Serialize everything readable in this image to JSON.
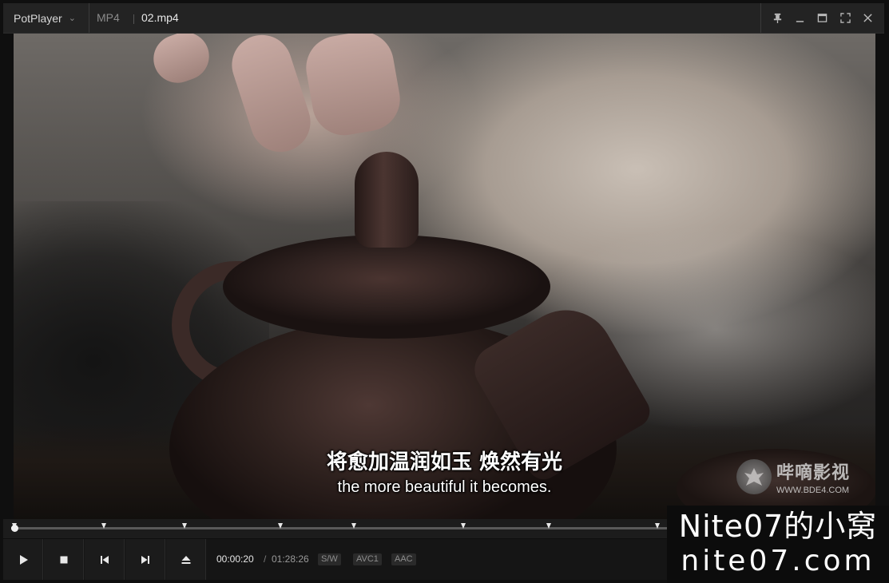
{
  "titlebar": {
    "app_name": "PotPlayer",
    "format": "MP4",
    "filename": "02.mp4",
    "controls": [
      "pin-icon",
      "minimize-icon",
      "maximize-icon",
      "fullscreen-icon",
      "close-icon"
    ]
  },
  "video": {
    "subtitle_cn": "将愈加温润如玉 焕然有光",
    "subtitle_en": "the more beautiful it becomes."
  },
  "watermark_bde": {
    "name": "哔嘀影视",
    "url": "WWW.BDE4.COM"
  },
  "seekbar": {
    "progress": 0.004,
    "chapter_marks": [
      0.004,
      0.107,
      0.2,
      0.311,
      0.395,
      0.522,
      0.62,
      0.746
    ]
  },
  "controls": {
    "buttons": [
      "play-icon",
      "stop-icon",
      "previous-icon",
      "next-icon",
      "eject-icon"
    ],
    "time_current": "00:00:20",
    "time_separator": "/",
    "time_total": "01:28:26",
    "badges": [
      "S/W",
      "AVC1",
      "AAC"
    ]
  },
  "watermark_nite": {
    "line1": "Nite07的小窝",
    "line2": "nite07.com"
  },
  "colors": {
    "titlebar_bg": "#232323",
    "control_bg": "#151515",
    "seek_track": "#5a5a5a",
    "seek_fill": "#dcdcdc"
  }
}
